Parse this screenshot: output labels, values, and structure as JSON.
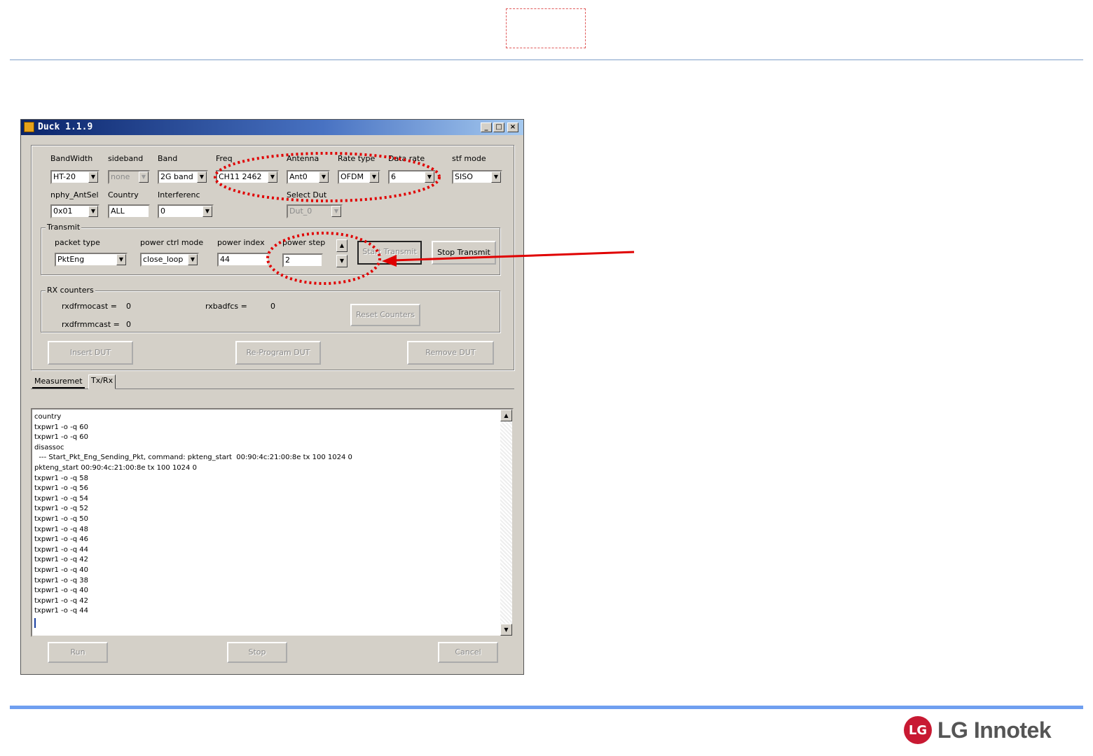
{
  "window": {
    "title": "Duck 1.1.9",
    "controls": {
      "minimize": "_",
      "maximize": "□",
      "close": "×"
    }
  },
  "settings": {
    "bandwidth": {
      "label": "BandWidth",
      "value": "HT-20"
    },
    "sideband": {
      "label": "sideband",
      "value": "none"
    },
    "band": {
      "label": "Band",
      "value": "2G band"
    },
    "freq": {
      "label": "Freq",
      "value": "CH11 2462"
    },
    "antenna": {
      "label": "Antenna",
      "value": "Ant0"
    },
    "rate_type": {
      "label": "Rate type",
      "value": "OFDM"
    },
    "data_rate": {
      "label": "Data rate",
      "value": "6"
    },
    "stf_mode": {
      "label": "stf mode",
      "value": "SISO"
    },
    "nphy_antsel": {
      "label": "nphy_AntSel",
      "value": "0x01"
    },
    "country": {
      "label": "Country",
      "value": "ALL"
    },
    "interference": {
      "label": "Interferenc",
      "value": "0"
    },
    "select_dut": {
      "label": "Select Dut",
      "value": "Dut_0"
    }
  },
  "transmit": {
    "group_label": "Transmit",
    "packet_type": {
      "label": "packet type",
      "value": "PktEng"
    },
    "power_ctrl_mode": {
      "label": "power ctrl mode",
      "value": "close_loop"
    },
    "power_index": {
      "label": "power index",
      "value": "44"
    },
    "power_step": {
      "label": "power step",
      "value": "2"
    },
    "start_button": "Start Transmit",
    "stop_button": "Stop Transmit"
  },
  "rx_counters": {
    "group_label": "RX counters",
    "rxdfrmocast": {
      "label": "rxdfrmocast =",
      "value": "0"
    },
    "rxdfrmmcast": {
      "label": "rxdfrmmcast =",
      "value": "0"
    },
    "rxbadfcs": {
      "label": "rxbadfcs =",
      "value": "0"
    },
    "reset_button": "Reset Counters"
  },
  "dut_buttons": {
    "insert": "Insert DUT",
    "reprogram": "Re-Program DUT",
    "remove": "Remove DUT"
  },
  "tabs": [
    "Measuremet",
    "Tx/Rx"
  ],
  "log_lines": [
    "country",
    "txpwr1 -o -q 60",
    "txpwr1 -o -q 60",
    "disassoc",
    "  --- Start_Pkt_Eng_Sending_Pkt, command: pkteng_start  00:90:4c:21:00:8e tx 100 1024 0",
    "pkteng_start 00:90:4c:21:00:8e tx 100 1024 0",
    "txpwr1 -o -q 58",
    "txpwr1 -o -q 56",
    "txpwr1 -o -q 54",
    "txpwr1 -o -q 52",
    "txpwr1 -o -q 50",
    "txpwr1 -o -q 48",
    "txpwr1 -o -q 46",
    "txpwr1 -o -q 44",
    "txpwr1 -o -q 42",
    "txpwr1 -o -q 40",
    "txpwr1 -o -q 38",
    "txpwr1 -o -q 40",
    "txpwr1 -o -q 42",
    "txpwr1 -o -q 44"
  ],
  "bottom_buttons": {
    "run": "Run",
    "stop": "Stop",
    "cancel": "Cancel"
  },
  "logo": {
    "mark": "LG",
    "text": "LG Innotek"
  },
  "colors": {
    "annotation": "#e00000",
    "accent_line": "#6f9ff0",
    "brand": "#c81932"
  }
}
